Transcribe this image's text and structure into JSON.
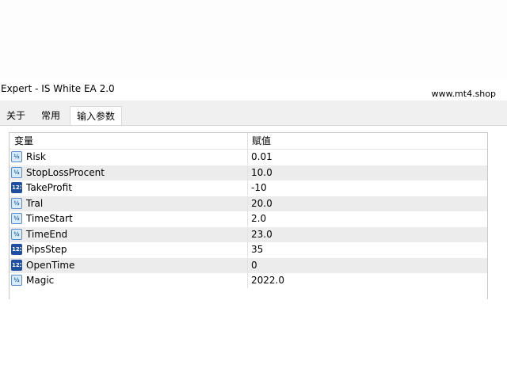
{
  "window": {
    "title": "Expert - IS White EA 2.0"
  },
  "watermark": "www.mt4.shop",
  "tabs": [
    {
      "label": "关于",
      "active": false
    },
    {
      "label": "常用",
      "active": false
    },
    {
      "label": "输入参数",
      "active": true
    }
  ],
  "table": {
    "headers": {
      "variable": "变量",
      "value": "赋值"
    },
    "rows": [
      {
        "icon": "fraction-icon",
        "icon_text": "½",
        "name": "Risk",
        "value": "0.01"
      },
      {
        "icon": "fraction-icon",
        "icon_text": "½",
        "name": "StopLossProcent",
        "value": "10.0"
      },
      {
        "icon": "integer-icon",
        "icon_text": "123",
        "name": "TakeProfit",
        "value": "-10"
      },
      {
        "icon": "fraction-icon",
        "icon_text": "½",
        "name": "Tral",
        "value": "20.0"
      },
      {
        "icon": "fraction-icon",
        "icon_text": "½",
        "name": "TimeStart",
        "value": "2.0"
      },
      {
        "icon": "fraction-icon",
        "icon_text": "½",
        "name": "TimeEnd",
        "value": "23.0"
      },
      {
        "icon": "integer-icon",
        "icon_text": "123",
        "name": "PipsStep",
        "value": "35"
      },
      {
        "icon": "integer-icon",
        "icon_text": "123",
        "name": "OpenTime",
        "value": "0"
      },
      {
        "icon": "fraction-icon",
        "icon_text": "½",
        "name": "Magic",
        "value": "2022.0"
      }
    ]
  },
  "colors": {
    "alt_row": "#ececec",
    "frac_icon": "#d8ecfb",
    "int_icon": "#1f4fa0"
  }
}
